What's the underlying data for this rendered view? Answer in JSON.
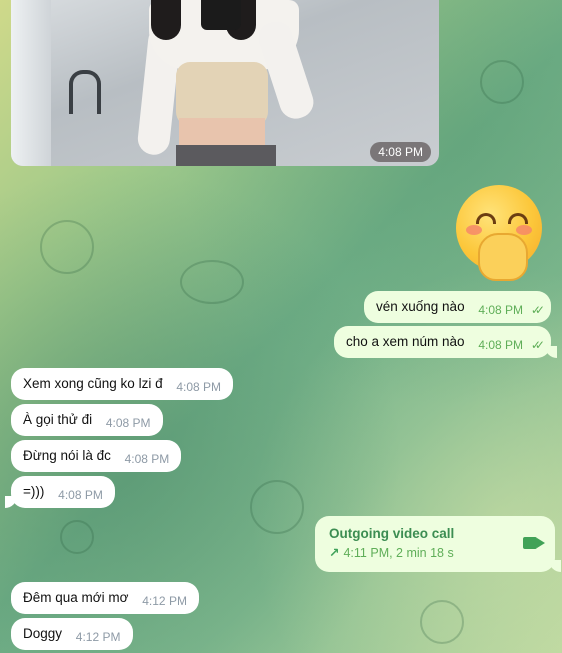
{
  "photo_message": {
    "time": "4:08 PM"
  },
  "sticker": {
    "icon": "hand-over-mouth-emoji-icon"
  },
  "outgoing_messages": [
    {
      "text": "vén xuống nào",
      "time": "4:08 PM"
    },
    {
      "text": "cho a xem núm nào",
      "time": "4:08 PM"
    }
  ],
  "incoming_messages": [
    {
      "text": "Xem xong cũng ko lzi đ",
      "time": "4:08 PM"
    },
    {
      "text": "À gọi thử đi",
      "time": "4:08 PM"
    },
    {
      "text": "Đừng nói là đc",
      "time": "4:08 PM"
    },
    {
      "text": "=)))",
      "time": "4:08 PM"
    }
  ],
  "video_call": {
    "title": "Outgoing video call",
    "meta": "4:11 PM, 2 min 18 s",
    "arrow_icon": "outgoing-arrow-icon",
    "camera_icon": "video-camera-icon"
  },
  "later_messages": [
    {
      "text": "Đêm qua mới mơ",
      "time": "4:12 PM"
    },
    {
      "text": "Doggy",
      "time": "4:12 PM"
    }
  ],
  "colors": {
    "outgoing_bubble": "#eefedf",
    "incoming_bubble": "#ffffff",
    "time_incoming": "#8e9aa6",
    "time_outgoing": "#5fae58",
    "call_accent": "#3c8d52"
  }
}
